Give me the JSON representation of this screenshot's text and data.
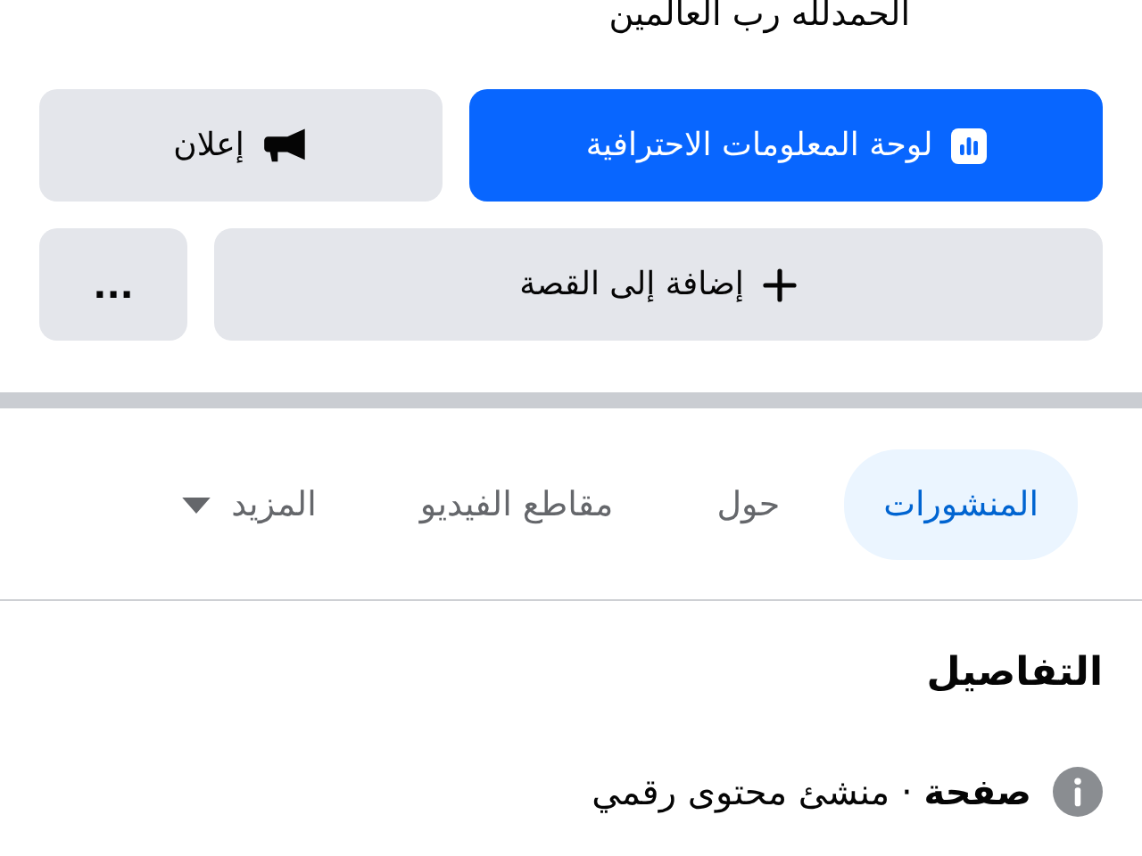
{
  "header_text": "الحمدلله رب العالمين",
  "action_rows": [
    [
      {
        "kind": "primary",
        "label": "لوحة المعلومات الاحترافية"
      },
      {
        "kind": "secondary",
        "label": "إعلان"
      }
    ],
    [
      {
        "kind": "secondary",
        "label": "إضافة إلى القصة"
      },
      {
        "kind": "more",
        "label": "..."
      }
    ]
  ],
  "tabs": [
    {
      "label": "المنشورات",
      "selected": true,
      "dropdown": false
    },
    {
      "label": "حول",
      "selected": false,
      "dropdown": false
    },
    {
      "label": "مقاطع الفيديو",
      "selected": false,
      "dropdown": false
    },
    {
      "label": "المزيد",
      "selected": false,
      "dropdown": true
    }
  ],
  "details": {
    "title": "التفاصيل",
    "items": [
      {
        "text": "**صفحة** · منشئ محتوى رقمي"
      }
    ]
  }
}
